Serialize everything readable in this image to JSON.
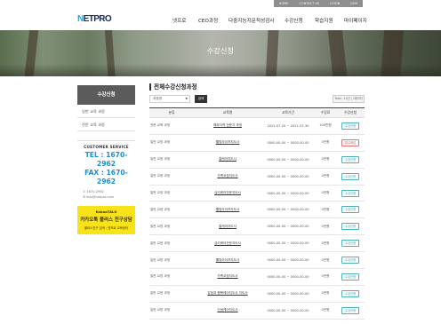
{
  "topbar": {
    "links": [
      "HOME",
      "CONTACT US",
      "LOGIN",
      "JOIN"
    ]
  },
  "header": {
    "logo": {
      "prefix": "N",
      "rest": "ETPRO"
    },
    "nav": [
      "넷프로",
      "CEO과정",
      "다중지능지문적성검사",
      "수강신청",
      "학습지원",
      "마이페이지"
    ]
  },
  "banner": {
    "title": "수강신청"
  },
  "sidebar": {
    "heading": "수강신청",
    "items": [
      "일반 교육 과정",
      "전문 교육 과정"
    ],
    "customer_service": {
      "title": "CUSTOMER SERVICE",
      "tel": "TEL : 1670-2962",
      "fax": "FAX : 1670-2962",
      "hours": "① 1670-2962",
      "email": "✉ edu@netpro.com"
    },
    "kakao": {
      "line1": "KakaoTALK",
      "line2": "카카오톡 플러스 친구상담",
      "line3": "플러스친구 검색 : 넷프로 교육센터"
    }
  },
  "main": {
    "title": "전체수강신청과정",
    "filter": {
      "select": "과정명",
      "search_button": "검색",
      "total": "Total : 15건 | 1페이지"
    },
    "columns": [
      "분류",
      "교육명",
      "교육기간",
      "수강료",
      "수강신청"
    ],
    "rows": [
      {
        "category": "전문 교육 과정",
        "name": "해외자격 전문가 과정",
        "period": "2021-07-20 ~ 2021-07-30",
        "fee": "100만원",
        "status": "수강신청",
        "closed": false
      },
      {
        "category": "일반 교양 과정",
        "name": "웰빙라이프지도사",
        "period": "0000-00-00 ~ 0000-00-00",
        "fee": "0만원",
        "status": "접수마감",
        "closed": true
      },
      {
        "category": "일반 교양 과정",
        "name": "홈케어지도사",
        "period": "0000-00-00 ~ 0000-00-00",
        "fee": "0만원",
        "status": "수강신청",
        "closed": false
      },
      {
        "category": "일반 교양 과정",
        "name": "가족코칭지도사",
        "period": "0000-00-00 ~ 0000-00-00",
        "fee": "0만원",
        "status": "수강신청",
        "closed": false
      },
      {
        "category": "일반 교양 과정",
        "name": "심리케어전문지도사",
        "period": "0000-00-00 ~ 0000-00-00",
        "fee": "0만원",
        "status": "수강신청",
        "closed": false
      },
      {
        "category": "일반 교양 과정",
        "name": "웰빙라이프지도사",
        "period": "0000-00-00 ~ 0000-00-00",
        "fee": "0만원",
        "status": "수강신청",
        "closed": false
      },
      {
        "category": "일반 교양 과정",
        "name": "홈케어지도사",
        "period": "0000-00-00 ~ 0000-00-00",
        "fee": "0만원",
        "status": "수강신청",
        "closed": false
      },
      {
        "category": "일반 교양 과정",
        "name": "심리케어전문지도사",
        "period": "0000-00-00 ~ 0000-00-00",
        "fee": "0만원",
        "status": "수강신청",
        "closed": false
      },
      {
        "category": "일반 교양 과정",
        "name": "웰빙라이프지도사",
        "period": "0000-00-00 ~ 0000-00-00",
        "fee": "0만원",
        "status": "수강신청",
        "closed": false
      },
      {
        "category": "일반 교양 과정",
        "name": "가족코칭지도사",
        "period": "0000-00-00 ~ 0000-00-00",
        "fee": "0만원",
        "status": "수강신청",
        "closed": false
      },
      {
        "category": "일반 교양 과정",
        "name": "감정과 행복케어지도사 지도사",
        "period": "0000-00-00 ~ 0000-00-00",
        "fee": "0만원",
        "status": "수강신청",
        "closed": false
      },
      {
        "category": "일반 교양 과정",
        "name": "인생케어지도사",
        "period": "0000-00-00 ~ 0000-00-00",
        "fee": "0만원",
        "status": "수강신청",
        "closed": false
      },
      {
        "category": "일반 교양 과정",
        "name": "세토케어리더 소녀지도사",
        "period": "0000-00-00 ~ 0000-00-00",
        "fee": "0만원",
        "status": "수강신청",
        "closed": false
      }
    ]
  },
  "colors": {
    "accent": "#1f8fcf",
    "apply": "#4bb3b8",
    "closed": "#d04040",
    "kakao": "#f7e318"
  }
}
